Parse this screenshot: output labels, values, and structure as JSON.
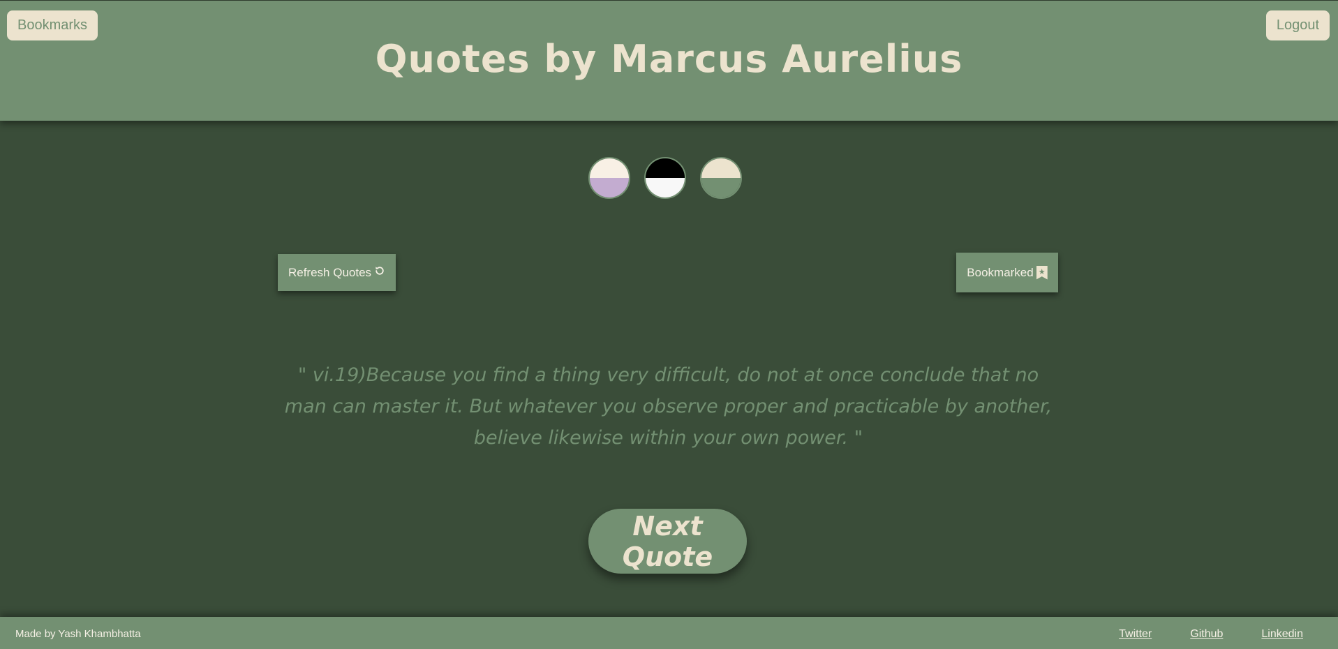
{
  "header": {
    "bookmarks_label": "Bookmarks",
    "logout_label": "Logout",
    "title": "Quotes by Marcus Aurelius"
  },
  "themes": [
    {
      "name": "cream-lavender",
      "top": "#f8f0e5",
      "bottom": "#c3acd0"
    },
    {
      "name": "black-white",
      "top": "#000000",
      "bottom": "#f8f8f8"
    },
    {
      "name": "beige-green",
      "top": "#ece3ce",
      "bottom": "#739072"
    }
  ],
  "actions": {
    "refresh_label": "Refresh Quotes",
    "refresh_icon": "refresh-icon",
    "bookmarked_label": "Bookmarked",
    "bookmarked_icon": "bookmark-icon"
  },
  "quote": {
    "text": "\" vi.19)Because you find a thing very difficult, do not at once conclude that no man can master it. But whatever you observe proper and practicable by another, believe likewise within your own power. \""
  },
  "next_label": "Next Quote",
  "footer": {
    "credit": "Made by Yash Khambhatta",
    "links": [
      {
        "label": "Twitter"
      },
      {
        "label": "Github"
      },
      {
        "label": "Linkedin"
      }
    ]
  },
  "colors": {
    "background": "#3a4d39",
    "primary": "#739072",
    "accent": "#ece3ce"
  }
}
